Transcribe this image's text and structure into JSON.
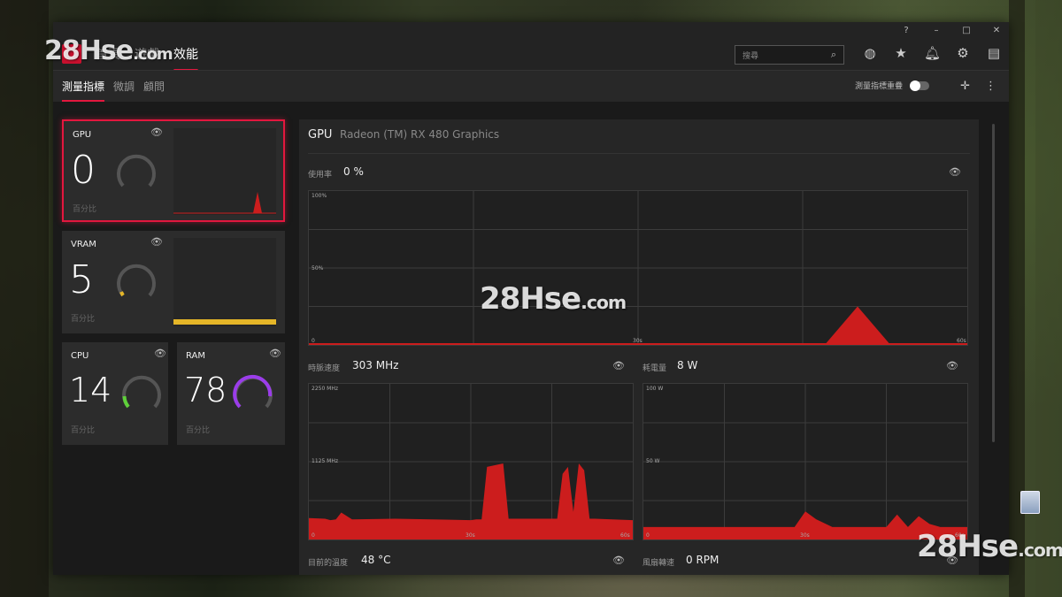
{
  "window": {
    "help_glyph": "?",
    "minimize_glyph": "–",
    "maximize_glyph": "□",
    "close_glyph": "✕"
  },
  "topnav": {
    "tabs": [
      {
        "label": "首頁"
      },
      {
        "label": "遊戲"
      },
      {
        "label": "效能",
        "active": true
      }
    ],
    "search_placeholder": "搜尋",
    "icons": [
      "globe-icon",
      "star-icon",
      "bell-icon",
      "gear-icon",
      "sidebar-icon"
    ]
  },
  "subnav": {
    "tabs": [
      {
        "label": "測量指標",
        "active": true
      },
      {
        "label": "微調"
      },
      {
        "label": "顧問"
      }
    ],
    "overlay_label": "測量指標重疊"
  },
  "tiles": [
    {
      "name": "GPU",
      "value": "0",
      "unit": "百分比",
      "percent": 0
    },
    {
      "name": "VRAM",
      "value": "5",
      "unit": "百分比",
      "percent": 5
    },
    {
      "name": "CPU",
      "value": "14",
      "unit": "百分比",
      "percent": 14
    },
    {
      "name": "RAM",
      "value": "78",
      "unit": "百分比",
      "percent": 78
    }
  ],
  "panel": {
    "title": "GPU",
    "subtitle": "Radeon (TM) RX 480 Graphics",
    "usage": {
      "label": "使用率",
      "value": "0 %"
    },
    "clock": {
      "label": "時脈速度",
      "value": "303 MHz"
    },
    "power": {
      "label": "耗電量",
      "value": "8 W"
    },
    "temp": {
      "label": "目前的溫度",
      "value": "48 °C"
    },
    "fan": {
      "label": "風扇轉速",
      "value": "0 RPM"
    }
  },
  "colors": {
    "accent": "#e3173e",
    "chart_fill": "#cc1d1d",
    "vram": "#e5b628",
    "cpu": "#5fd03a",
    "ram": "#9b3dea"
  },
  "chart_data": [
    {
      "type": "area",
      "title": "使用率",
      "y_tick_labels": [
        "100%",
        "50%",
        "0"
      ],
      "x_tick_labels": [
        "30s",
        "60s"
      ],
      "ylim": [
        0,
        100
      ],
      "x": [
        0,
        5,
        10,
        15,
        20,
        25,
        30,
        35,
        40,
        44,
        47,
        50,
        53,
        56,
        60
      ],
      "values": [
        0,
        0,
        0,
        0,
        0,
        0,
        0,
        0,
        0,
        0,
        0,
        25,
        0,
        0,
        0
      ]
    },
    {
      "type": "area",
      "title": "時脈速度",
      "y_tick_labels": [
        "2250 MHz",
        "1125 MHz",
        "0"
      ],
      "x_tick_labels": [
        "30s",
        "60s"
      ],
      "ylim": [
        0,
        2250
      ],
      "x": [
        0,
        3,
        4,
        5,
        6,
        8,
        16,
        30,
        31,
        32,
        33,
        36,
        37,
        45,
        46,
        47,
        48,
        49,
        50,
        51,
        52,
        53,
        60
      ],
      "values": [
        310,
        300,
        280,
        290,
        390,
        290,
        300,
        280,
        290,
        290,
        1050,
        1100,
        300,
        300,
        300,
        950,
        1050,
        400,
        1100,
        1000,
        300,
        300,
        280
      ]
    },
    {
      "type": "area",
      "title": "耗電量",
      "y_tick_labels": [
        "100 W",
        "50 W",
        "0"
      ],
      "x_tick_labels": [
        "30s",
        "60s"
      ],
      "ylim": [
        0,
        100
      ],
      "x": [
        0,
        10,
        20,
        28,
        30,
        32,
        35,
        45,
        47,
        49,
        51,
        53,
        55,
        60
      ],
      "values": [
        8,
        8,
        8,
        8,
        18,
        13,
        8,
        8,
        16,
        8,
        15,
        10,
        8,
        8
      ]
    }
  ]
}
